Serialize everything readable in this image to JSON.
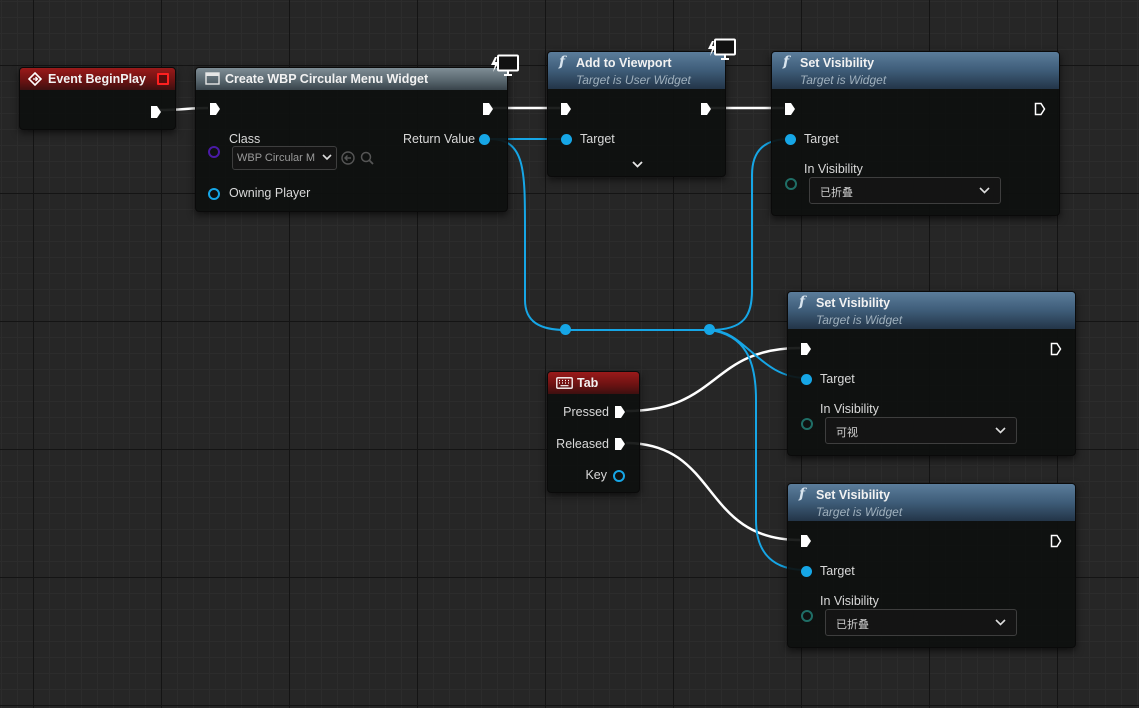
{
  "colors": {
    "object_wire": "#16a6e6",
    "exec_wire": "#ffffff",
    "event_header": "#8a1717",
    "function_header": "#3e5c78",
    "macro_header": "#5a6870"
  },
  "nodes": {
    "begin_play": {
      "title": "Event BeginPlay"
    },
    "create_widget": {
      "title": "Create WBP Circular Menu Widget",
      "class_label": "Class",
      "class_value": "WBP Circular M",
      "return_label": "Return Value",
      "owner_label": "Owning Player"
    },
    "add_to_viewport": {
      "title": "Add to Viewport",
      "subtitle": "Target is User Widget",
      "target_label": "Target"
    },
    "set_vis_1": {
      "title": "Set Visibility",
      "subtitle": "Target is Widget",
      "target_label": "Target",
      "vis_label": "In Visibility",
      "vis_value": "已折叠"
    },
    "set_vis_2": {
      "title": "Set Visibility",
      "subtitle": "Target is Widget",
      "target_label": "Target",
      "vis_label": "In Visibility",
      "vis_value": "可视"
    },
    "set_vis_3": {
      "title": "Set Visibility",
      "subtitle": "Target is Widget",
      "target_label": "Target",
      "vis_label": "In Visibility",
      "vis_value": "已折叠"
    },
    "tab_key": {
      "title": "Tab",
      "pressed_label": "Pressed",
      "released_label": "Released",
      "key_label": "Key"
    }
  }
}
